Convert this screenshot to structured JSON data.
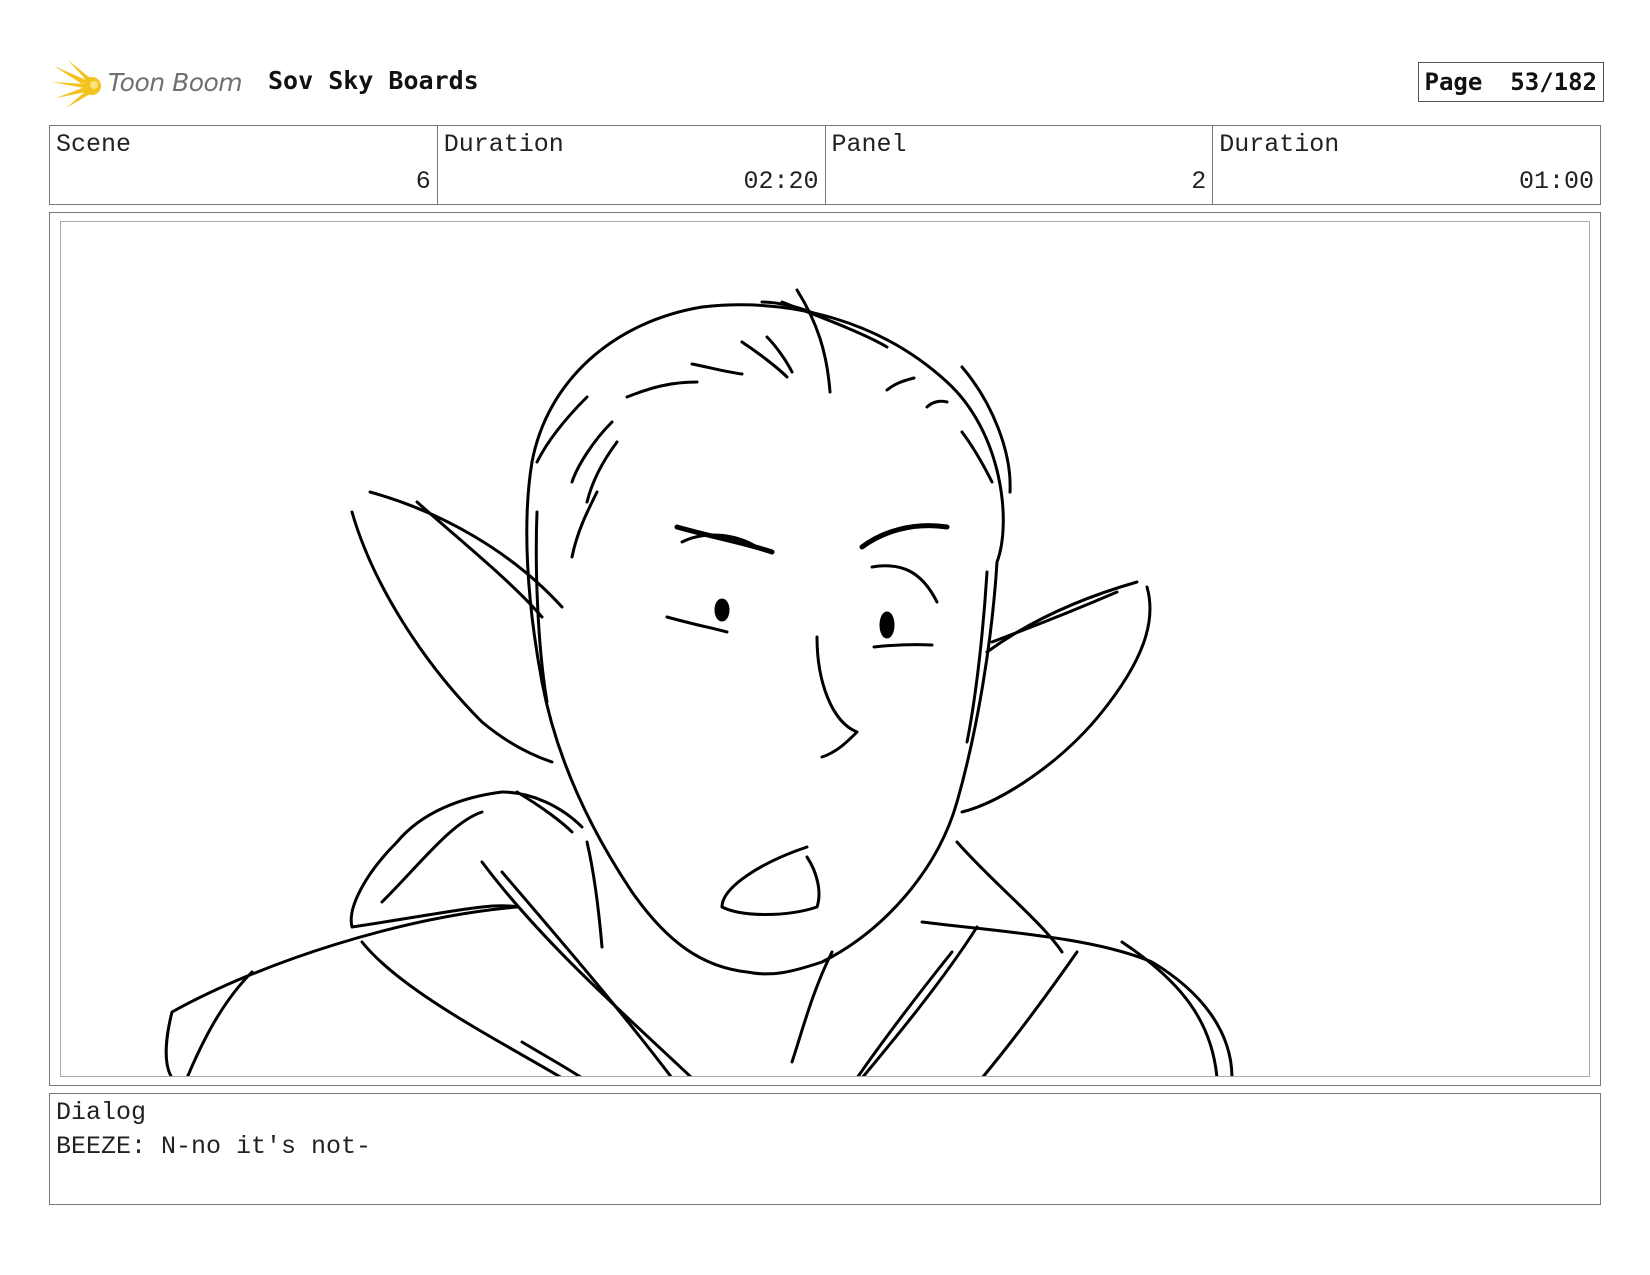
{
  "header": {
    "logo_text": "Toon Boom",
    "title": "Sov Sky Boards",
    "page_label": "Page",
    "page_value": "53/182"
  },
  "info": {
    "scene_label": "Scene",
    "scene_value": "6",
    "scene_duration_label": "Duration",
    "scene_duration_value": "02:20",
    "panel_label": "Panel",
    "panel_value": "2",
    "panel_duration_label": "Duration",
    "panel_duration_value": "01:00"
  },
  "dialog": {
    "label": "Dialog",
    "text": "BEEZE: N-no it's not-"
  },
  "colors": {
    "logo_star": "#f4c21c",
    "sketch_ink": "#000000",
    "frame_border": "#777777"
  }
}
